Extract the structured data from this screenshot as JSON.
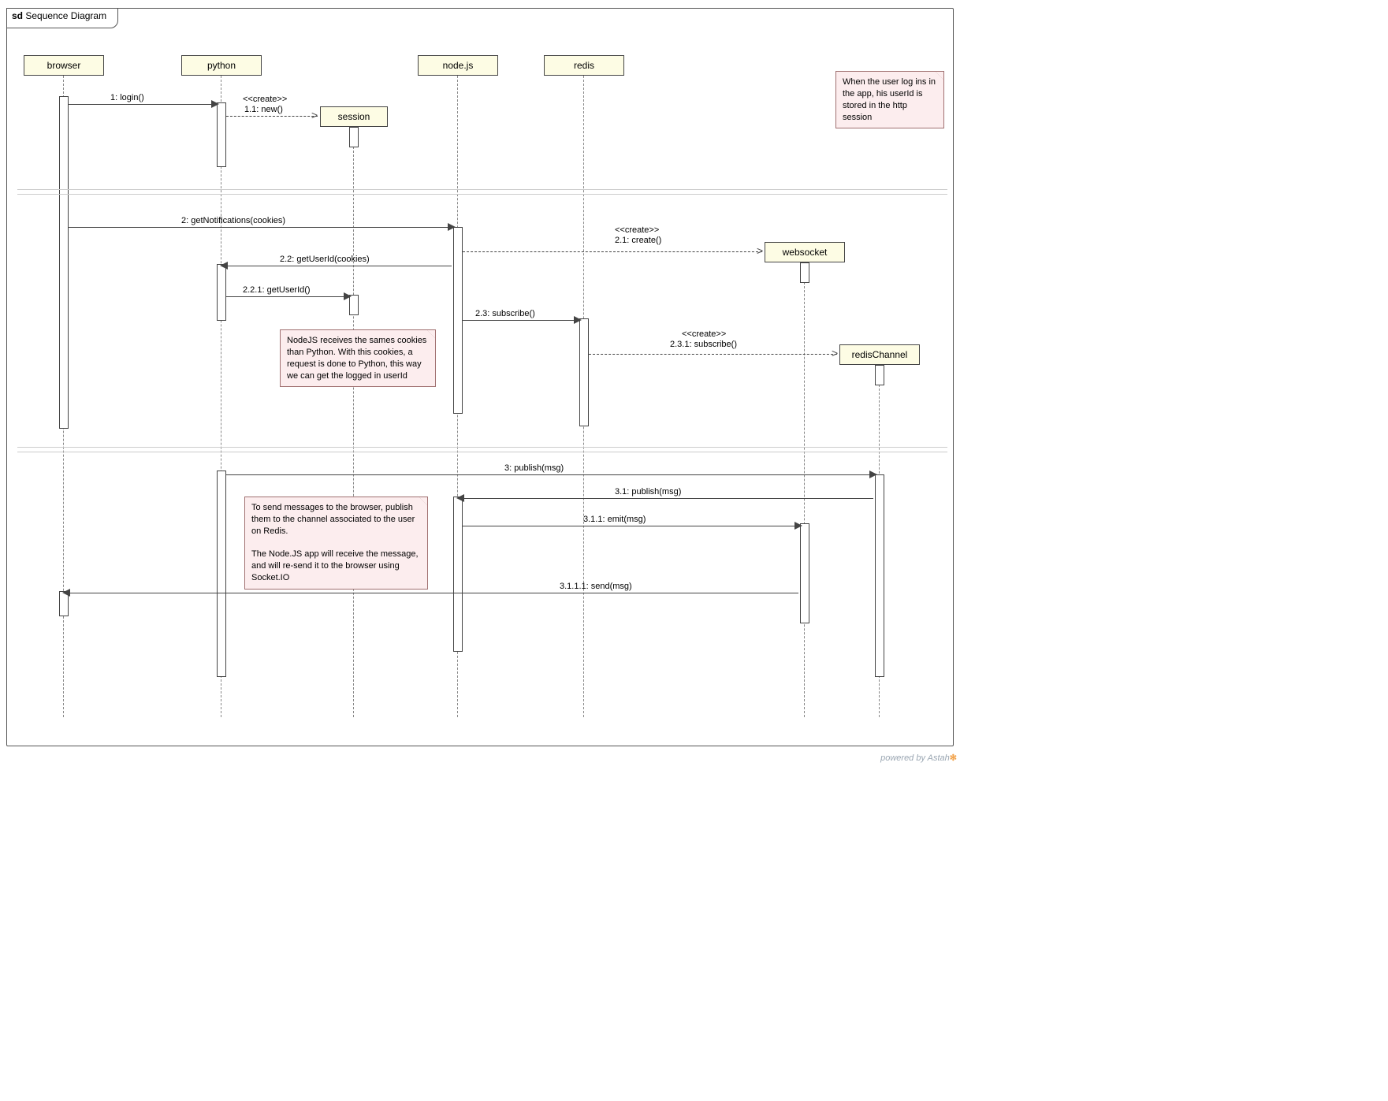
{
  "frame": {
    "prefix": "sd",
    "title": "Sequence Diagram"
  },
  "lifelines": {
    "browser": "browser",
    "python": "python",
    "nodejs": "node.js",
    "redis": "redis",
    "session": "session",
    "websocket": "websocket",
    "redisChannel": "redisChannel"
  },
  "stereotypes": {
    "create": "<<create>>"
  },
  "messages": {
    "m1": "1: login()",
    "m1_1": "1.1: new()",
    "m2": "2: getNotifications(cookies)",
    "m2_1": "2.1: create()",
    "m2_2": "2.2: getUserId(cookies)",
    "m2_2_1": "2.2.1: getUserId()",
    "m2_3": "2.3: subscribe()",
    "m2_3_1": "2.3.1: subscribe()",
    "m3": "3: publish(msg)",
    "m3_1": "3.1: publish(msg)",
    "m3_1_1": "3.1.1: emit(msg)",
    "m3_1_1_1": "3.1.1.1: send(msg)"
  },
  "notes": {
    "n1": "When the user log ins in the app, his userId is stored in the http session",
    "n2": "NodeJS receives the sames cookies than Python. With this cookies, a request is done to Python, this way we can get the logged in userId",
    "n3a": "To send messages to the  browser, publish them to the channel associated to the user on Redis.",
    "n3b": "The Node.JS app will receive the message, and will re-send it to the browser using Socket.IO"
  },
  "footer": {
    "prefix": "powered by ",
    "brand": "Astah",
    "suffix": ""
  }
}
